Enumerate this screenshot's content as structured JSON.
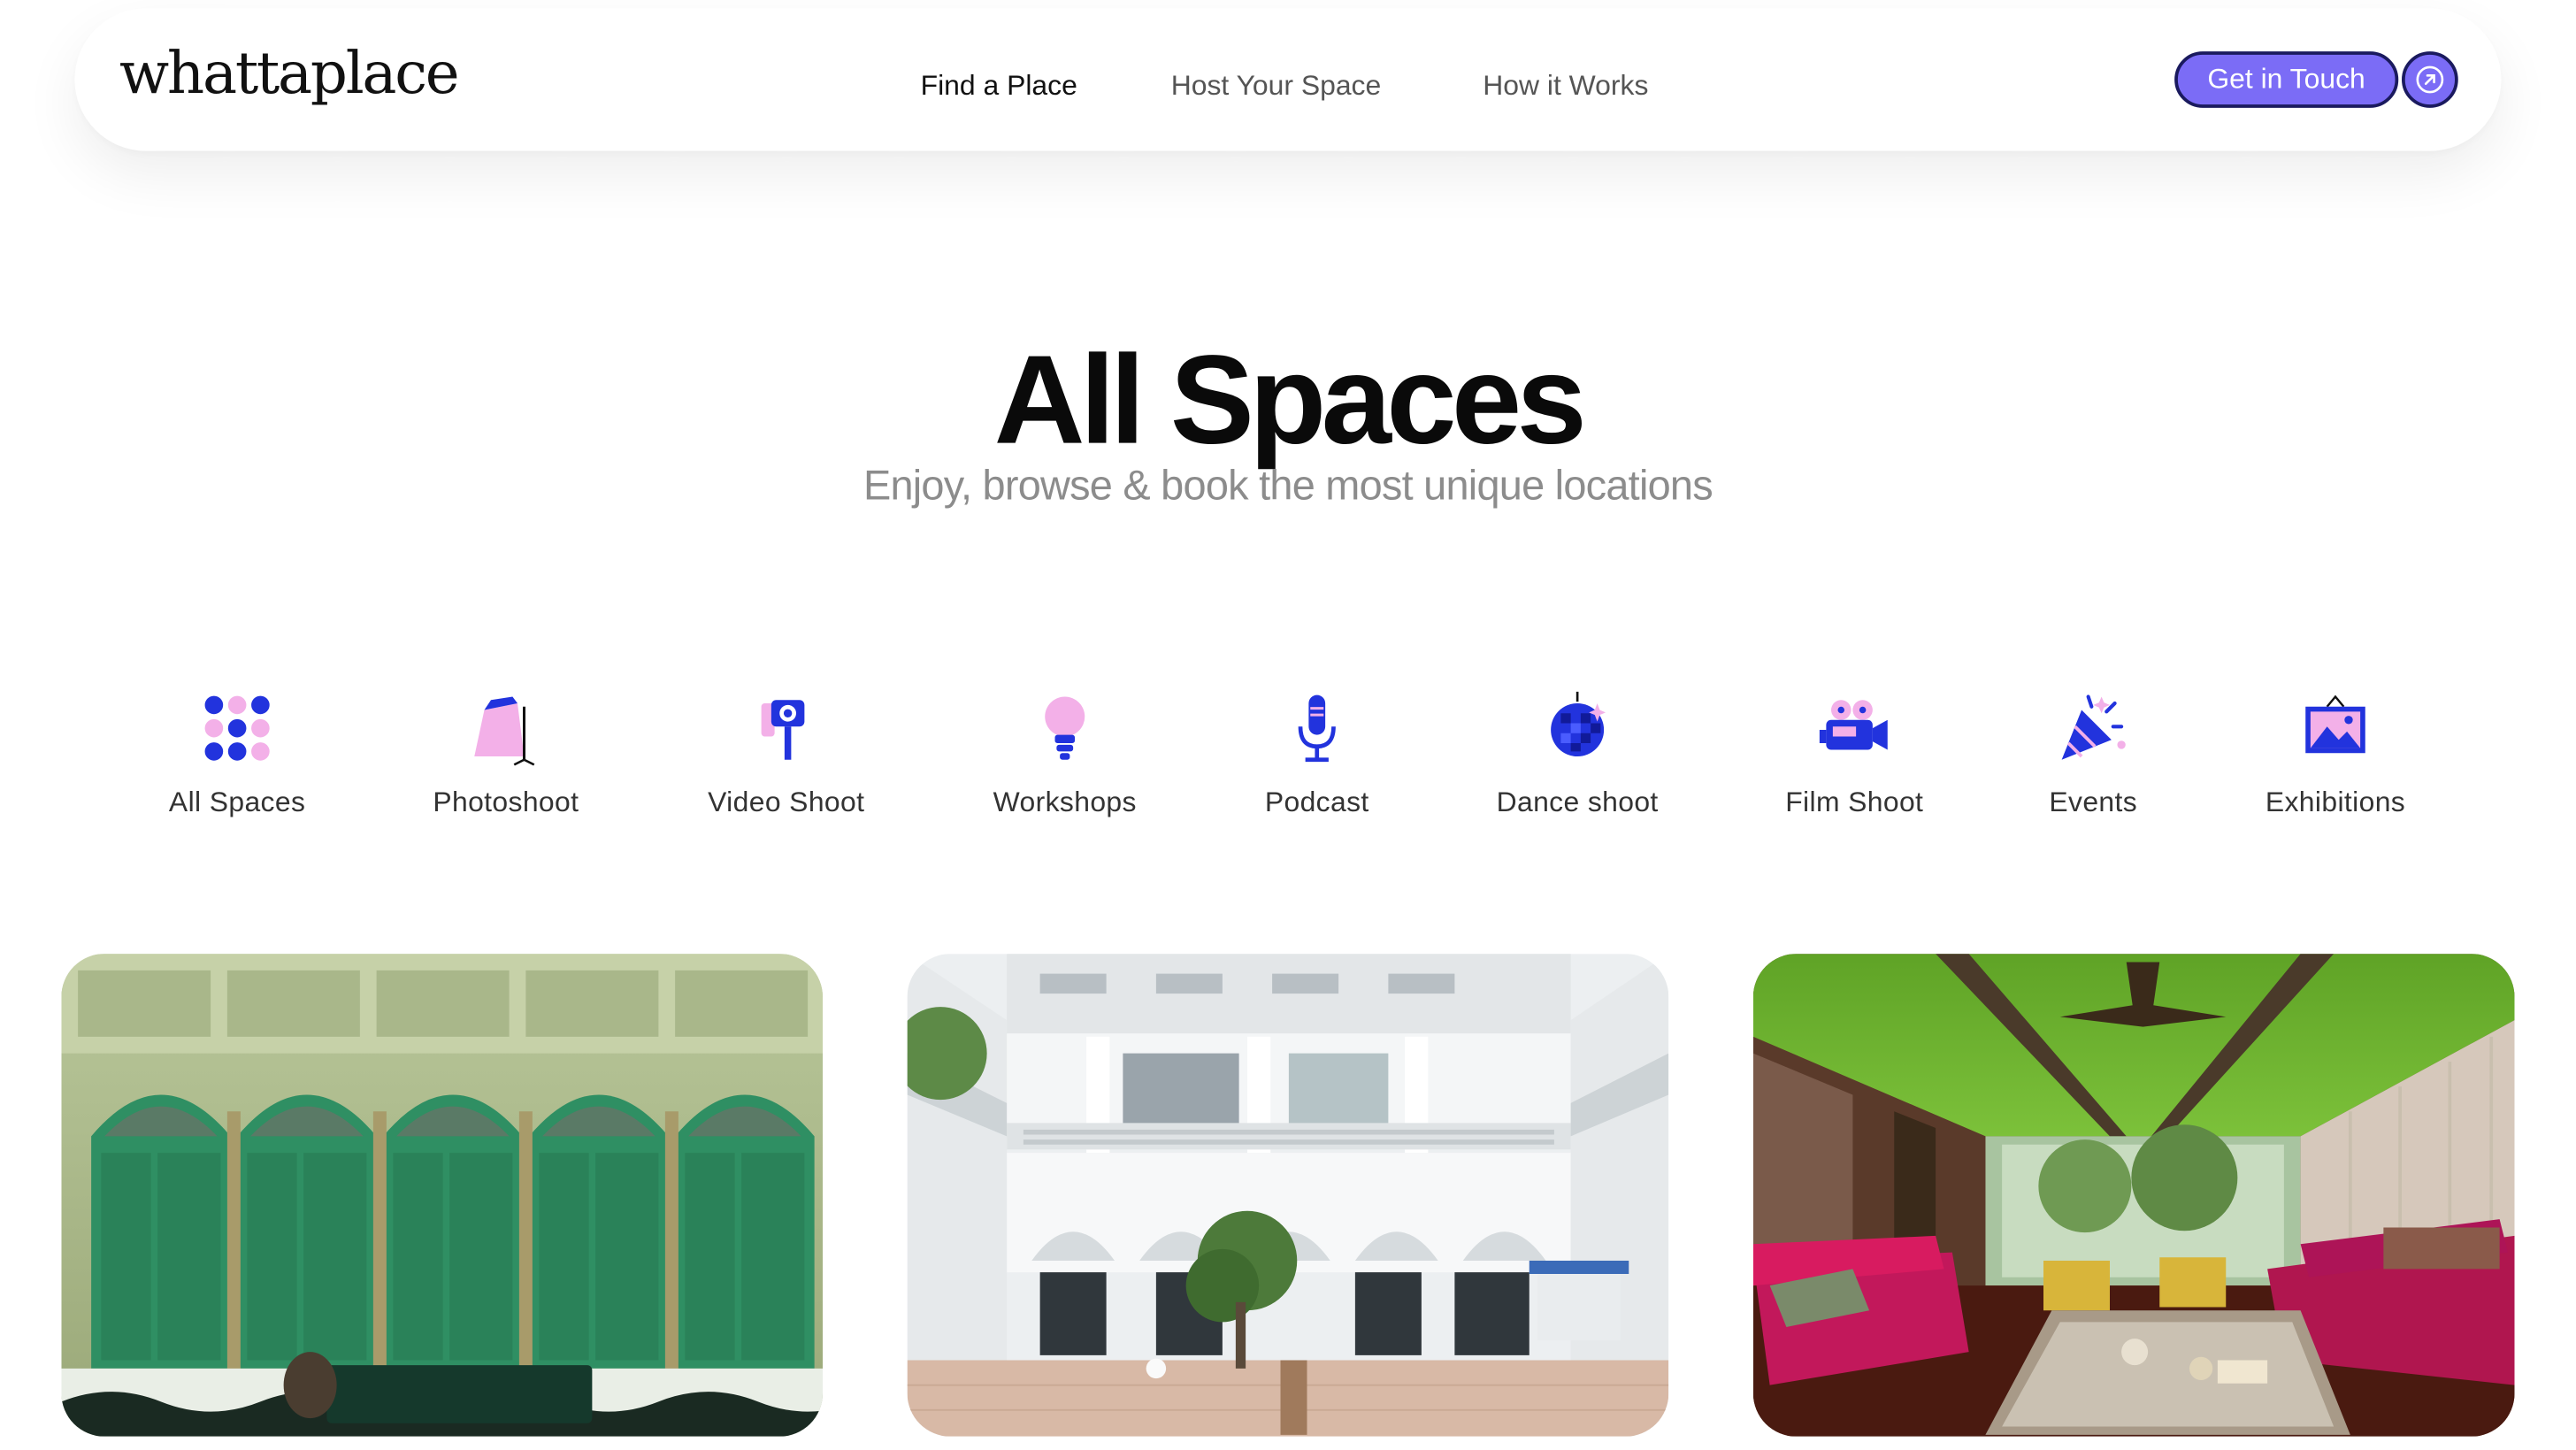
{
  "brand": {
    "logo_text": "whattaplace"
  },
  "nav": {
    "links": [
      {
        "label": "Find a Place",
        "active": true
      },
      {
        "label": "Host Your Space",
        "active": false
      },
      {
        "label": "How it Works",
        "active": false
      }
    ],
    "cta_label": "Get in Touch",
    "cta_icon": "arrow-up-right-circle-icon"
  },
  "hero": {
    "title": "All Spaces",
    "subtitle": "Enjoy, browse & book the most unique locations"
  },
  "categories": [
    {
      "label": "All Spaces",
      "icon": "dots-grid-icon"
    },
    {
      "label": "Photoshoot",
      "icon": "studio-light-icon"
    },
    {
      "label": "Video Shoot",
      "icon": "camera-on-stand-icon"
    },
    {
      "label": "Workshops",
      "icon": "lightbulb-icon"
    },
    {
      "label": "Podcast",
      "icon": "microphone-icon"
    },
    {
      "label": "Dance shoot",
      "icon": "disco-ball-icon"
    },
    {
      "label": "Film Shoot",
      "icon": "film-camera-icon"
    },
    {
      "label": "Events",
      "icon": "party-popper-icon"
    },
    {
      "label": "Exhibitions",
      "icon": "framed-picture-icon"
    }
  ],
  "listings": [
    {
      "image": "green-arched-doors-haveli"
    },
    {
      "image": "white-colonial-courtyard"
    },
    {
      "image": "green-ceiling-pink-sofa-lounge"
    }
  ],
  "colors": {
    "accent": "#7b6cf6",
    "icon_blue": "#2233dd",
    "icon_pink": "#f3b0e8",
    "title": "#0a0a0a",
    "subtitle": "#8c8c8c"
  }
}
